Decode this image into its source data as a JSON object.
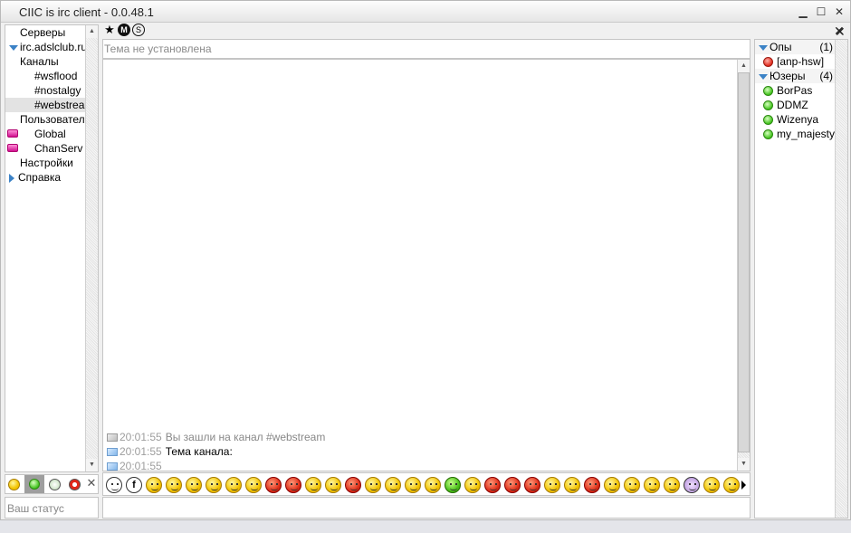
{
  "app": {
    "title": "CIIC is irc client - 0.0.48.1"
  },
  "window_controls": {
    "minimize": "▁",
    "maximize": "☐",
    "close": "✕"
  },
  "left_tree": {
    "servers_label": "Серверы",
    "server_name": "irc.adslclub.ru",
    "channels_label": "Каналы",
    "channels": [
      "#wsflood",
      "#nostalgy",
      "#webstream"
    ],
    "users_label": "Пользователи",
    "users": [
      "Global",
      "ChanServ"
    ],
    "settings_label": "Настройки",
    "help_label": "Справка"
  },
  "status_input": {
    "placeholder": "Ваш статус"
  },
  "topic": {
    "text": "Тема не установлена"
  },
  "messages": [
    {
      "time": "20:01:55",
      "text": "Вы зашли на канал #webstream",
      "style": "grey"
    },
    {
      "time": "20:01:55",
      "text": "Тема канала:",
      "style": "normal"
    },
    {
      "time": "20:01:55",
      "text": "",
      "style": "normal"
    }
  ],
  "toolbar": {
    "star": "★",
    "m": "M",
    "s": "S",
    "close": "✕"
  },
  "right_panel": {
    "ops_label": "Опы",
    "ops_count": "(1)",
    "ops": [
      "[anp-hsw]"
    ],
    "users_label": "Юзеры",
    "users_count": "(4)",
    "users": [
      "BorPas",
      "DDMZ",
      "Wizenya",
      "my_majesty"
    ],
    "close": "✕"
  },
  "colors": {
    "accent": "#3b82c6",
    "op_status": "#e0281a",
    "user_status": "#3fc21a"
  }
}
